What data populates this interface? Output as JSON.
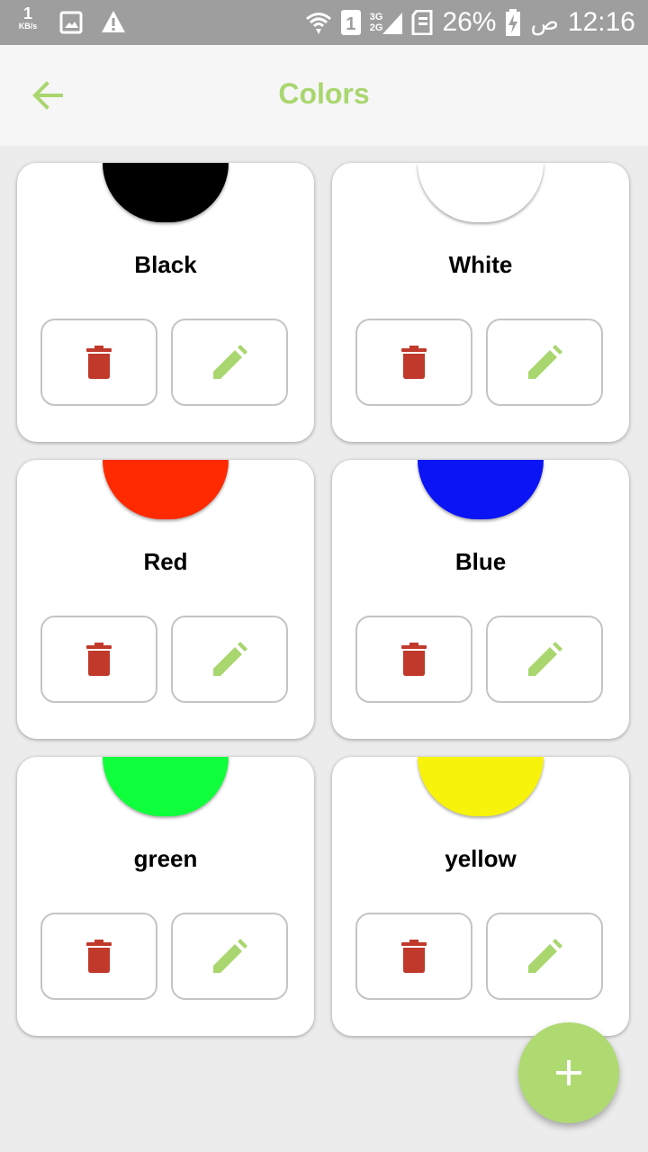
{
  "status_bar": {
    "speed_value": "1",
    "speed_unit": "KB/s",
    "sim_number": "1",
    "network_top": "3G",
    "network_bottom": "2G",
    "battery_percent": "26%",
    "time_suffix": "ص",
    "time": "12:16",
    "icons": [
      "image-icon",
      "warning-icon",
      "wifi-icon",
      "sim-icon",
      "signal-icon",
      "sd-card-icon",
      "battery-charging-icon"
    ]
  },
  "appbar": {
    "title": "Colors",
    "back_icon": "arrow-left-icon",
    "accent_color": "#a9d66f"
  },
  "colors": [
    {
      "name": "Black",
      "swatch": "#000000"
    },
    {
      "name": "White",
      "swatch": "#ffffff"
    },
    {
      "name": "Red",
      "swatch": "#ff2a00"
    },
    {
      "name": "Blue",
      "swatch": "#0a14f5"
    },
    {
      "name": "green",
      "swatch": "#10ff3c"
    },
    {
      "name": "yellow",
      "swatch": "#f8f30a"
    }
  ],
  "actions": {
    "delete_icon": "trash-icon",
    "delete_color": "#c0392b",
    "edit_icon": "pencil-icon",
    "edit_color": "#a9d66f"
  },
  "fab": {
    "icon": "plus-icon",
    "color": "#afda72"
  }
}
